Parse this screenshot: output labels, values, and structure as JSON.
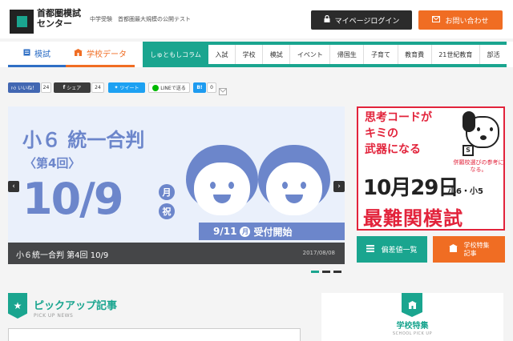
{
  "header": {
    "logo_text": "首都圏模試センター",
    "tagline": "中学受験　首都圏最大規模の公開テスト",
    "login_label": "マイページログイン",
    "contact_label": "お問い合わせ"
  },
  "nav": {
    "tab_moshi": "模試",
    "tab_school": "学校データ",
    "tab_column": "しゅともしコラム",
    "links": [
      "入試",
      "学校",
      "模試",
      "イベント",
      "帰国生",
      "子育て",
      "教育費",
      "21世紀教育",
      "部活"
    ]
  },
  "social": {
    "like": "いいね！",
    "like_count": "24",
    "share": "シェア",
    "share_count": "24",
    "tweet": "ツイート",
    "line": "LINEで送る",
    "hatena": "B!",
    "hatena_count": "0"
  },
  "banner": {
    "title": "小６ 統一合判",
    "round": "〈第4回〉",
    "date": "10/9",
    "month_char": "月",
    "holiday_char": "祝",
    "start_date": "9/11",
    "start_dow": "月",
    "start_label": "受付開始",
    "caption": "小６統一合判 第4回 10/9",
    "caption_date": "2017/08/08",
    "prev": "‹",
    "next": "›"
  },
  "ad": {
    "line1": "思考コードが",
    "line2": "キミの",
    "line3": "武器になる",
    "date": "10月29日",
    "grades": "小6・小5",
    "note": "併願校選びの参考になる。",
    "exam": "最難関模試",
    "dog_letter": "S"
  },
  "buttons": {
    "hensa": "偏差値一覧",
    "feature_l1": "学校特集",
    "feature_l2": "記事"
  },
  "pickup": {
    "title": "ピックアップ記事",
    "sub": "PICK UP NEWS"
  },
  "school_feature": {
    "title": "学校特集",
    "sub": "SCHOOL PICK UP"
  },
  "colors": {
    "teal": "#1aa58f",
    "orange": "#f06d23",
    "blue": "#2f6fc5",
    "banner_blue": "#6c86cb",
    "ad_red": "#e2233b"
  }
}
